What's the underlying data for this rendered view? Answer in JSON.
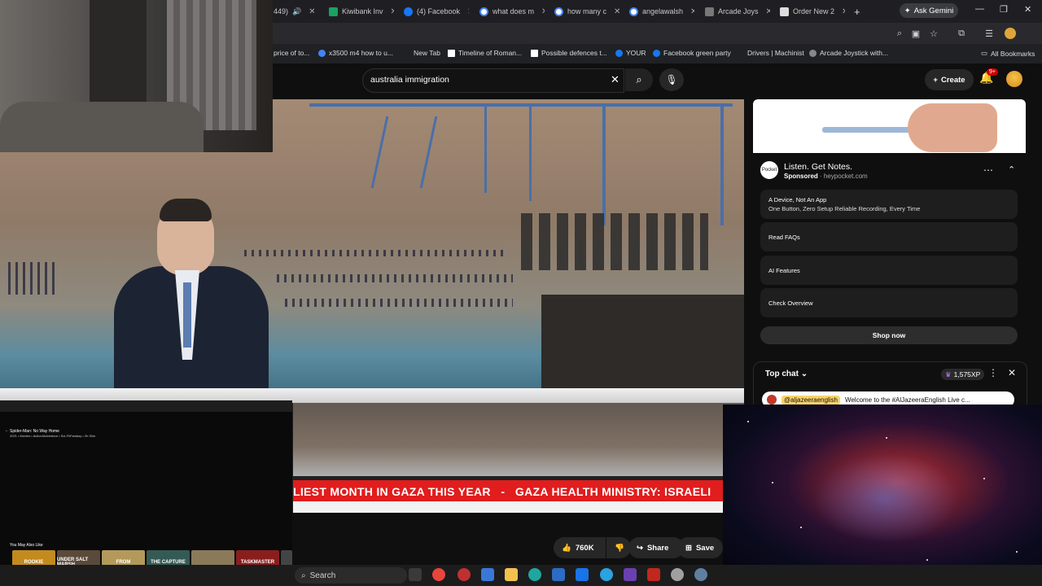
{
  "browser": {
    "tabs": [
      {
        "label": "449)",
        "color": "#d93025"
      },
      {
        "label": "Kiwibank Inv",
        "color": "#1aa260"
      },
      {
        "label": "(4) Facebook",
        "color": "#1877f2"
      },
      {
        "label": "what does m",
        "color": "#4285f4"
      },
      {
        "label": "how many c",
        "color": "#4285f4"
      },
      {
        "label": "angelawalsh",
        "color": "#4285f4"
      },
      {
        "label": "Arcade Joys",
        "color": "#6a6a6a"
      },
      {
        "label": "Order New 2",
        "color": "#cfcfcf"
      }
    ],
    "ask_gemini": "Ask Gemini"
  },
  "bookmarks": [
    {
      "label": "price of to..."
    },
    {
      "label": "x3500 m4 how to u..."
    },
    {
      "label": "New Tab"
    },
    {
      "label": "Timeline of Roman..."
    },
    {
      "label": "Possible defences t..."
    },
    {
      "label": "YOUR"
    },
    {
      "label": "Facebook green party"
    },
    {
      "label": "Drivers | Machinist"
    },
    {
      "label": "Arcade Joystick with..."
    },
    {
      "label": "All Bookmarks"
    }
  ],
  "youtube": {
    "search_query": "australia immigration",
    "create_label": "Create",
    "notif_count": "9+"
  },
  "video": {
    "ticker": "LIEST MONTH IN GAZA THIS YEAR   -   GAZA HEALTH MINISTRY: ISRAELI"
  },
  "actions": {
    "likes": "760K",
    "share": "Share",
    "save": "Save"
  },
  "ad": {
    "title": "Listen. Get Notes.",
    "sponsored": "Sponsored",
    "domain": "heypocket.com",
    "logo": "Pocket",
    "rows": [
      {
        "title": "A Device, Not An App",
        "subtitle": "One Button, Zero Setup Reliable Recording, Every Time"
      },
      {
        "title": "Read FAQs"
      },
      {
        "title": "AI Features"
      },
      {
        "title": "Check Overview"
      }
    ],
    "cta": "Shop now"
  },
  "chat": {
    "title": "Top chat",
    "xp": "1,575XP",
    "pinned_handle": "@aljazeeraenglish",
    "pinned_text": "Welcome to the #AlJazeeraEnglish Live c..."
  },
  "netflix": {
    "title": "Spider-Man: No Way Home",
    "meta": "2021 • Movies • Action/Adventure • Sci-Fi/Fantasy • 2h 30m",
    "may_like": "You May Also Like",
    "thumbs": [
      {
        "label": "ROOKIE",
        "color": "#c28a1f"
      },
      {
        "label": "UNDER SALT MARSH",
        "color": "#5a4a3a"
      },
      {
        "label": "FROM",
        "color": "#b39a5a"
      },
      {
        "label": "THE CAPTURE",
        "color": "#355a55"
      },
      {
        "label": "",
        "color": "#8a7a5a"
      },
      {
        "label": "TASKMASTER",
        "color": "#8a1e1e"
      },
      {
        "label": "",
        "color": "#444"
      }
    ]
  },
  "taskbar": {
    "search_placeholder": "Search"
  }
}
